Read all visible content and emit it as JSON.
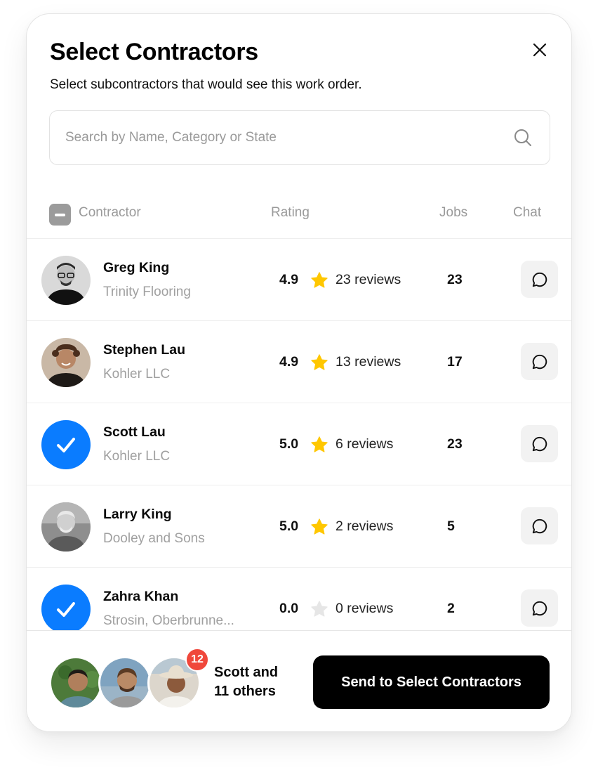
{
  "modal": {
    "title": "Select Contractors",
    "subtitle": "Select subcontractors that would see this work order.",
    "close_icon": "close-icon"
  },
  "search": {
    "placeholder": "Search by Name, Category or State",
    "value": "",
    "icon": "search-icon"
  },
  "table": {
    "select_all_state": "indeterminate",
    "columns": {
      "contractor": "Contractor",
      "rating": "Rating",
      "jobs": "Jobs",
      "chat": "Chat"
    },
    "rows": [
      {
        "name": "Greg King",
        "company": "Trinity Flooring",
        "rating": "4.9",
        "reviews": "23 reviews",
        "jobs": "23",
        "selected": false,
        "star_filled": true
      },
      {
        "name": "Stephen Lau",
        "company": "Kohler LLC",
        "rating": "4.9",
        "reviews": "13 reviews",
        "jobs": "17",
        "selected": false,
        "star_filled": true
      },
      {
        "name": "Scott Lau",
        "company": "Kohler LLC",
        "rating": "5.0",
        "reviews": "6 reviews",
        "jobs": "23",
        "selected": true,
        "star_filled": true
      },
      {
        "name": "Larry King",
        "company": "Dooley and Sons",
        "rating": "5.0",
        "reviews": "2 reviews",
        "jobs": "5",
        "selected": false,
        "star_filled": true
      },
      {
        "name": "Zahra Khan",
        "company": "Strosin, Oberbrunne...",
        "rating": "0.0",
        "reviews": "0 reviews",
        "jobs": "2",
        "selected": true,
        "star_filled": false
      }
    ]
  },
  "footer": {
    "selected_count_badge": "12",
    "summary_line1": "Scott and",
    "summary_line2": "11 others",
    "send_button": "Send to Select Contractors"
  },
  "colors": {
    "accent_blue": "#0a7cff",
    "star_yellow": "#ffc700",
    "star_empty": "#e6e6e6",
    "badge_red": "#f0473b",
    "primary_button": "#000000"
  }
}
